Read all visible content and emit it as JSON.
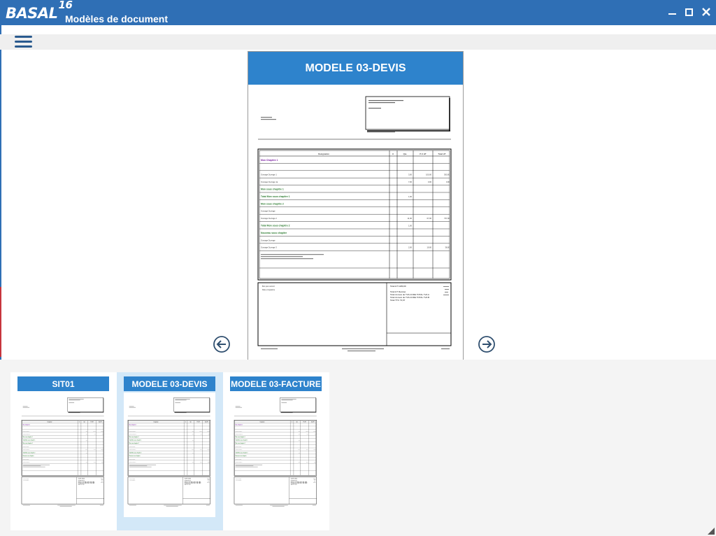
{
  "app": {
    "logo_text": "BASAL",
    "logo_version": "16",
    "title": "Modèles de document"
  },
  "preview": {
    "title": "MODELE 03-DEVIS"
  },
  "templates": [
    {
      "label": "SIT01",
      "selected": false
    },
    {
      "label": "MODELE 03-DEVIS",
      "selected": true
    },
    {
      "label": "MODELE 03-FACTURE",
      "selected": false
    }
  ],
  "document": {
    "table_headers": [
      "Designation",
      "U",
      "Qte",
      "P.U HT",
      "Total HT"
    ],
    "rows": [
      {
        "text": "Mon Chapitre 1",
        "style": "chapter",
        "qte": "",
        "pu": "",
        "total": ""
      },
      {
        "text": "",
        "style": "blank",
        "qte": "",
        "pu": "",
        "total": ""
      },
      {
        "text": "Ouvrage Ouvrage 1",
        "style": "normal",
        "qte": "3,00",
        "pu": "100,00",
        "total": "300,00"
      },
      {
        "text": "Ouvrage Ouvrage 1a",
        "style": "normal",
        "qte": "7,00",
        "pu": "0,00",
        "total": "0,00"
      },
      {
        "text": "Mon sous chapitre 1",
        "style": "sub",
        "qte": "",
        "pu": "",
        "total": ""
      },
      {
        "text": "Total  Mon sous chapitre 1",
        "style": "sub",
        "qte": "1,00",
        "pu": "",
        "total": ""
      },
      {
        "text": "Mon sous chapitre 2",
        "style": "sub",
        "qte": "",
        "pu": "",
        "total": ""
      },
      {
        "text": "Ouvrage Ouvrage",
        "style": "normal",
        "qte": "",
        "pu": "",
        "total": ""
      },
      {
        "text": "Ouvrage Ouvrage 2",
        "style": "normal",
        "qte": "11,00",
        "pu": "67,00",
        "total": "737,00"
      },
      {
        "text": "Total  Mon sous chapitre 2",
        "style": "sub",
        "qte": "1,00",
        "pu": "",
        "total": ""
      },
      {
        "text": "Nouveau sous chapitre",
        "style": "sub",
        "qte": "",
        "pu": "",
        "total": ""
      },
      {
        "text": "Ouvrage Ouvrage",
        "style": "normal",
        "qte": "",
        "pu": "",
        "total": ""
      },
      {
        "text": "Ouvrage Ouvrage 3",
        "style": "normal",
        "qte": "2,00",
        "pu": "19,00",
        "total": "38,00"
      }
    ],
    "total_ht": "Total HT   1180,00",
    "total_ht_remise": "Total HT Remisé",
    "tva_lines": [
      "Total du taux de TVA CODE TOTAL TVA A",
      "Total du taux de TVA CODE TOTAL TVA B"
    ],
    "total_ttc": "Total TTC     73,67",
    "side_labels": [
      "Bon pour accord",
      "Date et signature"
    ]
  },
  "colors": {
    "titlebar": "#2f6fb5",
    "accent": "#2e83cc",
    "selected": "#d3e8f8",
    "chapter_text": "#7b1fa2",
    "subchapter_text": "#2e7d32"
  }
}
